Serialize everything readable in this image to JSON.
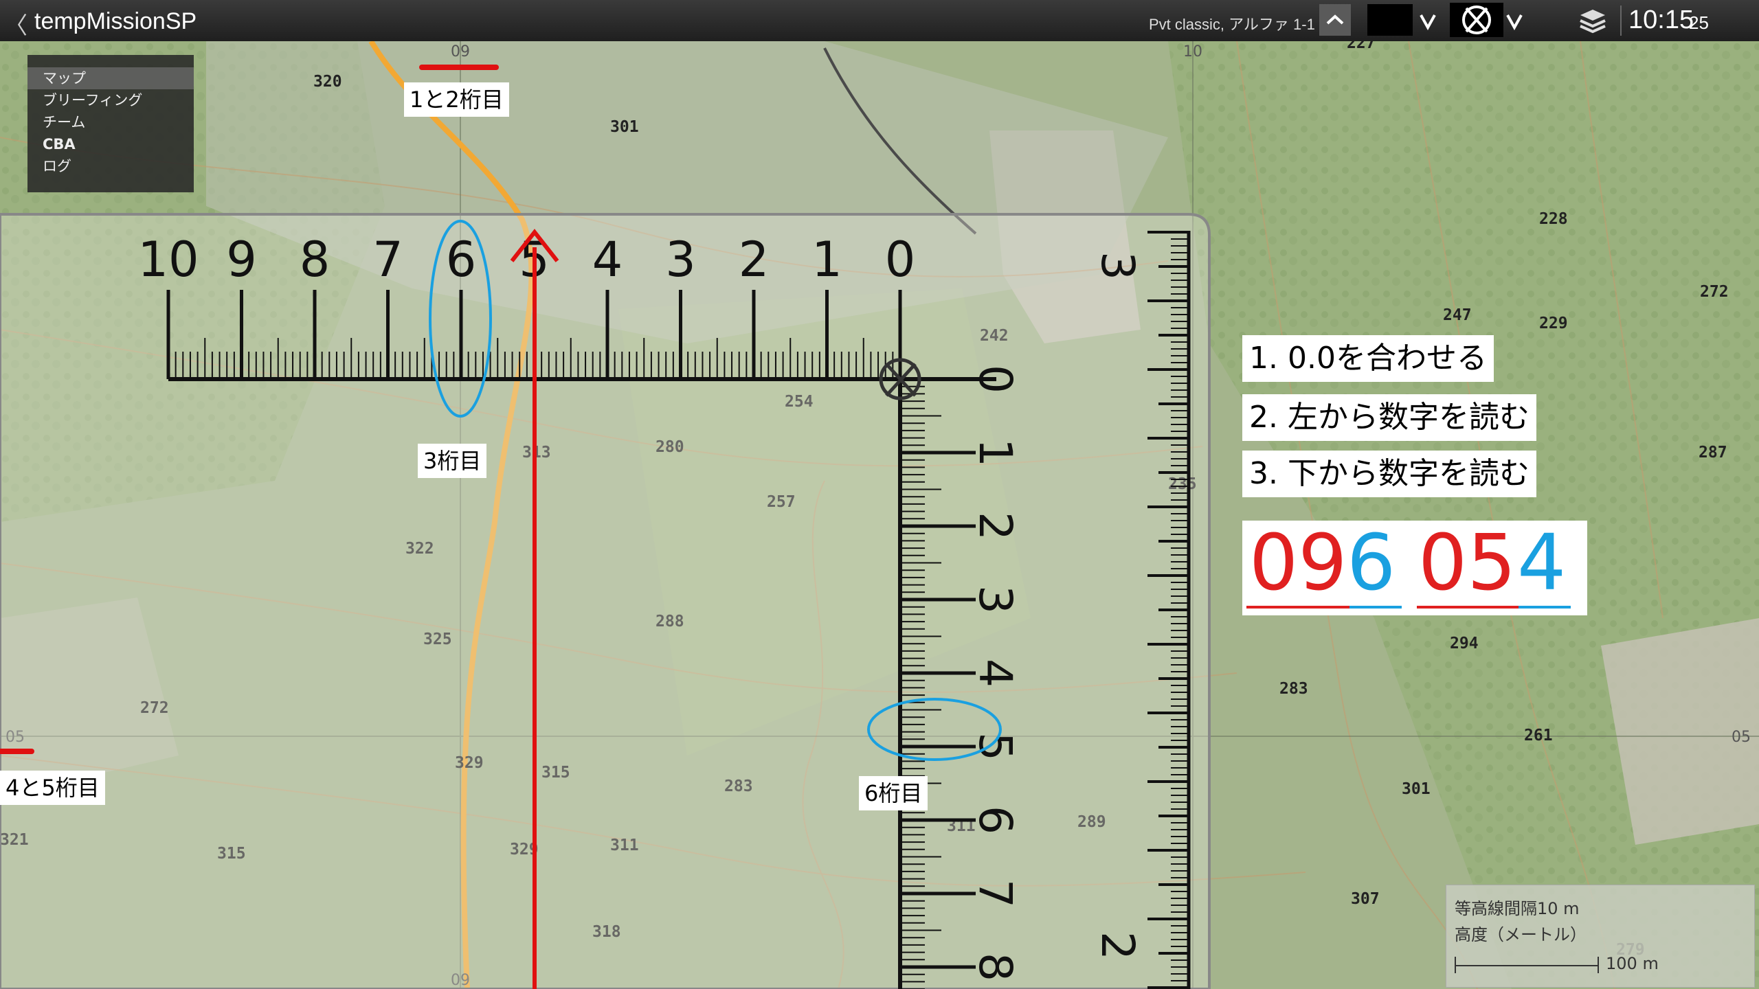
{
  "titlebar": {
    "back_glyph": "〈",
    "title": "tempMissionSP",
    "unit_info": "Pvt classic, アルファ 1-1 1",
    "time_main": "10:15",
    "time_seconds": "25"
  },
  "map_menu": {
    "items": [
      {
        "label": "マップ"
      },
      {
        "label": "ブリーフィング"
      },
      {
        "label": "チーム"
      },
      {
        "label": "CBA"
      },
      {
        "label": "ログ"
      }
    ]
  },
  "grid_labels": {
    "top_09": "09",
    "top_10": "10",
    "bottom_09": "09",
    "left_05": "05",
    "right_05": "05"
  },
  "elevations": [
    {
      "value": "320"
    },
    {
      "value": "301"
    },
    {
      "value": "227"
    },
    {
      "value": "228"
    },
    {
      "value": "272"
    },
    {
      "value": "247"
    },
    {
      "value": "229"
    },
    {
      "value": "242"
    },
    {
      "value": "254"
    },
    {
      "value": "280"
    },
    {
      "value": "313"
    },
    {
      "value": "257"
    },
    {
      "value": "235"
    },
    {
      "value": "287"
    },
    {
      "value": "322"
    },
    {
      "value": "288"
    },
    {
      "value": "294"
    },
    {
      "value": "325"
    },
    {
      "value": "283"
    },
    {
      "value": "272"
    },
    {
      "value": "261"
    },
    {
      "value": "329"
    },
    {
      "value": "315"
    },
    {
      "value": "283"
    },
    {
      "value": "301"
    },
    {
      "value": "311"
    },
    {
      "value": "289"
    },
    {
      "value": "321"
    },
    {
      "value": "315"
    },
    {
      "value": "329"
    },
    {
      "value": "311"
    },
    {
      "value": "307"
    },
    {
      "value": "318"
    },
    {
      "value": "279"
    }
  ],
  "ruler": {
    "h_numbers": [
      "10",
      "9",
      "8",
      "7",
      "6",
      "5",
      "4",
      "3",
      "2",
      "1",
      "0"
    ],
    "v_numbers": [
      "0",
      "1",
      "2",
      "3",
      "4",
      "5",
      "6",
      "7",
      "8"
    ],
    "side_top": "3",
    "side_bottom": "2"
  },
  "annotations": {
    "digits_1_2": "1と2桁目",
    "digit_3": "3桁目",
    "digits_4_5": "4と5桁目",
    "digit_6": "6桁目",
    "step1": "1. 0.0を合わせる",
    "step2": "2. 左から数字を読む",
    "step3": "3. 下から数字を読む"
  },
  "grid_coordinate": {
    "easting_main": "09",
    "easting_fine": "6",
    "northing_main": "05",
    "northing_fine": "4",
    "color_main": "#e02020",
    "color_fine": "#1aa0e0"
  },
  "legend": {
    "contour_interval": "等高線間隔10 m",
    "elevation_unit": "高度（メートル）",
    "scale": "100 m"
  },
  "colors": {
    "map_green": "#9fb088",
    "annotation_red": "#e01010",
    "annotation_blue": "#1aa0e0"
  }
}
